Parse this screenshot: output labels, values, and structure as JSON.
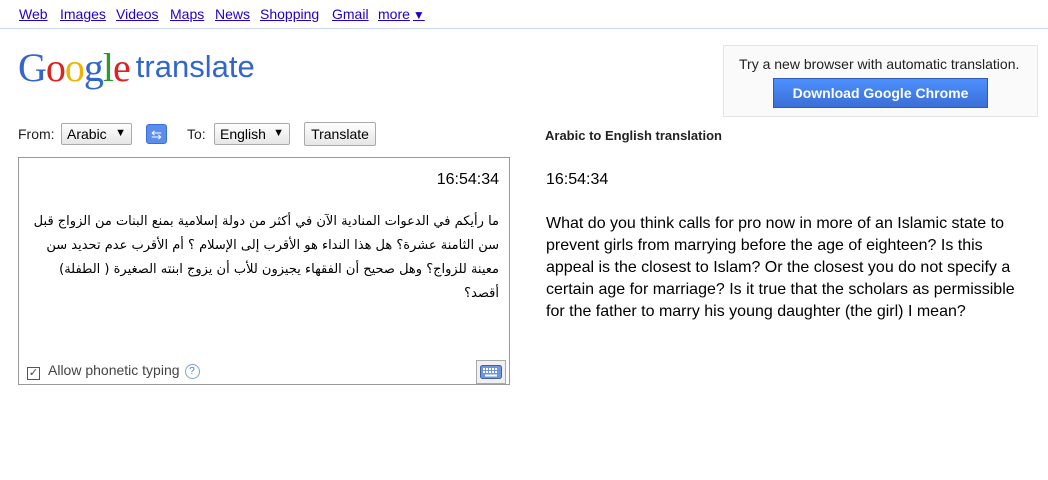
{
  "nav": {
    "items": [
      "Web",
      "Images",
      "Videos",
      "Maps",
      "News",
      "Shopping",
      "Gmail",
      "more"
    ],
    "more_arrow": "▼"
  },
  "logo": {
    "letters": [
      {
        "char": "G",
        "color": "#3366cc"
      },
      {
        "char": "o",
        "color": "#dd2222"
      },
      {
        "char": "o",
        "color": "#eeb500"
      },
      {
        "char": "g",
        "color": "#3366cc"
      },
      {
        "char": "l",
        "color": "#2a9a2a"
      },
      {
        "char": "e",
        "color": "#dd2222"
      }
    ],
    "product": "translate"
  },
  "promo": {
    "text": "Try a new browser with automatic translation.",
    "button": "Download Google Chrome"
  },
  "controls": {
    "from_label": "From:",
    "from_value": "Arabic",
    "to_label": "To:",
    "to_value": "English",
    "swap_icon": "⇆",
    "translate_button": "Translate"
  },
  "source": {
    "time": "16:54:34",
    "text": "ما رأيكم في الدعوات المنادية الآن في أكثر من دولة إسلامية بمنع البنات من الزواج قبل سن الثامنة عشرة؟ هل هذا النداء هو الأقرب إلى الإسلام ؟ أم الأقرب عدم تحديد سن معينة للزواج؟ وهل صحيح أن الفقهاء يجيزون للأب أن يزوج ابنته الصغيرة ( الطفلة) أقصد؟",
    "phonetic_label": "Allow phonetic typing",
    "phonetic_checked": "✓",
    "help_icon": "?"
  },
  "result": {
    "title": "Arabic to English translation",
    "time": "16:54:34",
    "text": "What do you think calls for pro now in more of an Islamic state to prevent girls from marrying before the age of eighteen? Is this appeal is the closest to Islam? Or the closest you do not specify a certain age for marriage? Is it true that the scholars as permissible for the father to marry his young daughter (the girl) I mean?"
  }
}
